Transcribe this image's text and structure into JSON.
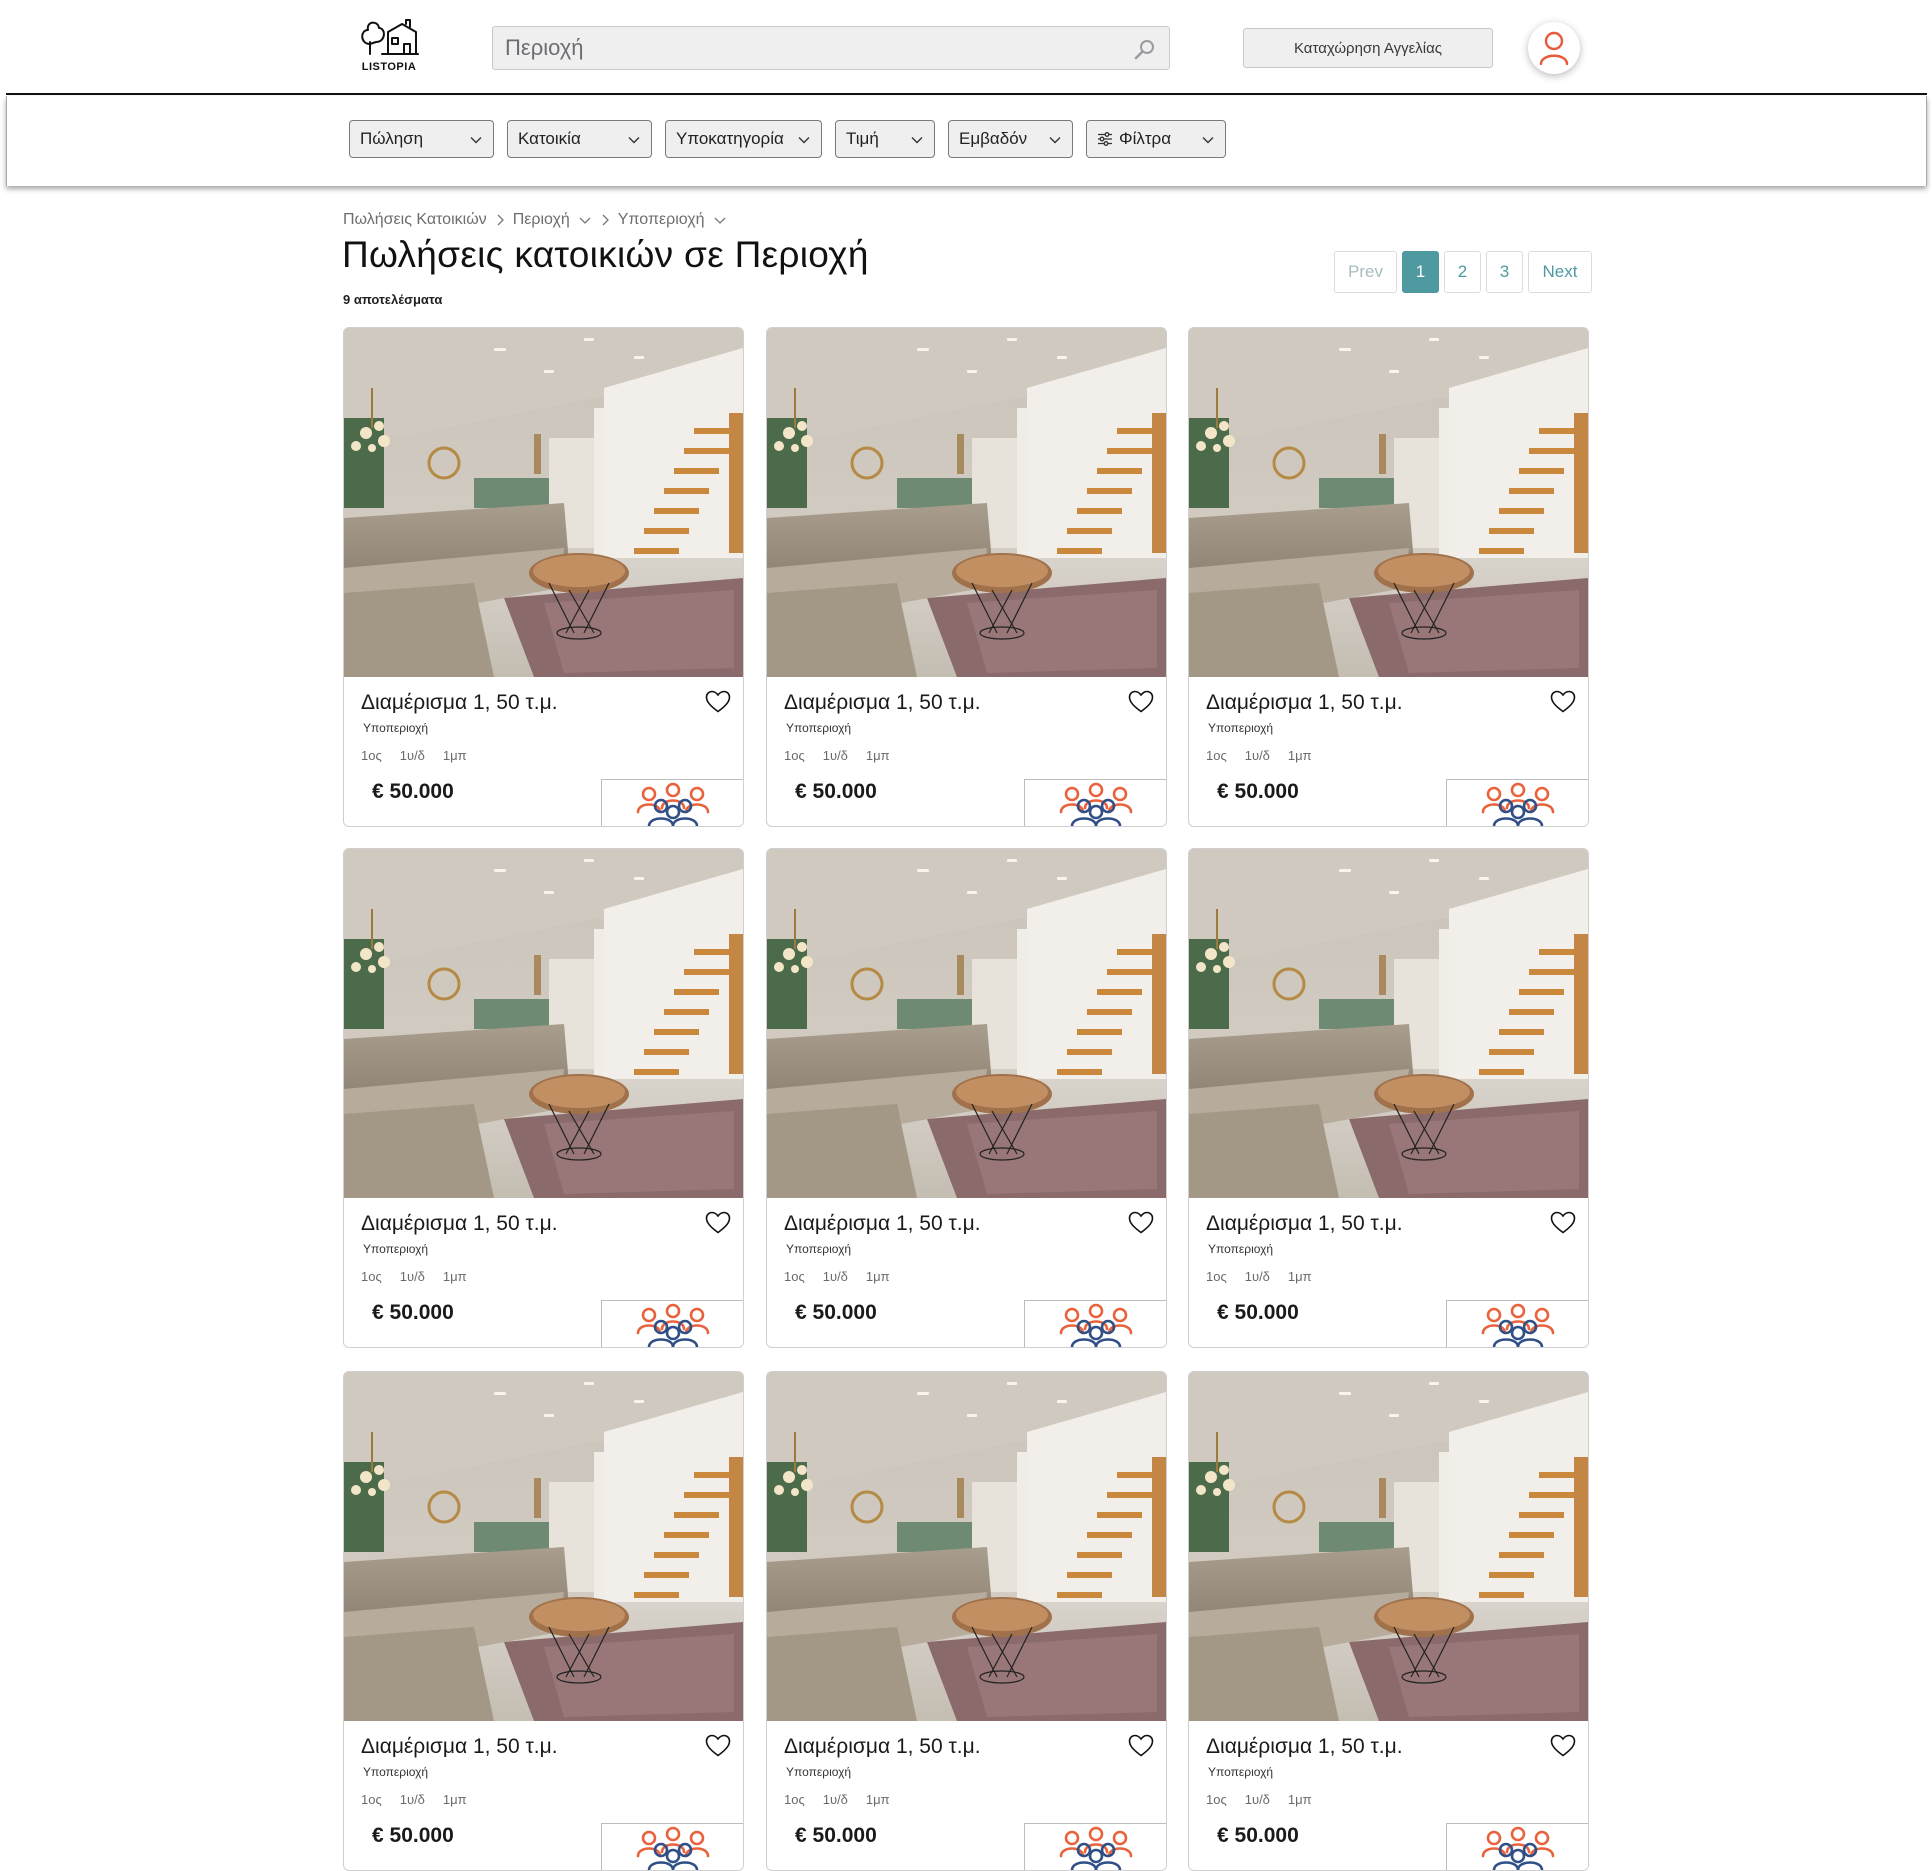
{
  "header": {
    "logo_text": "LISTOPIA",
    "search_placeholder": "Περιοχή",
    "post_listing_label": "Καταχώρηση Αγγελίας"
  },
  "filters": [
    {
      "label": "Πώληση"
    },
    {
      "label": "Κατοικία"
    },
    {
      "label": "Υποκατηγορία"
    },
    {
      "label": "Τιμή"
    },
    {
      "label": "Εμβαδόν"
    },
    {
      "label": "Φίλτρα"
    }
  ],
  "breadcrumb": {
    "root": "Πωλήσεις Κατοικιών",
    "area": "Περιοχή",
    "subarea": "Υποπεριοχή"
  },
  "page": {
    "title": "Πωλήσεις κατοικιών σε Περιοχή",
    "results_count": "9 αποτελέσματα"
  },
  "pagination": {
    "prev_label": "Prev",
    "pages": [
      "1",
      "2",
      "3"
    ],
    "current": "1",
    "next_label": "Next"
  },
  "listings": [
    {
      "title": "Διαμέρισμα 1, 50 τ.μ.",
      "subarea": "Υποπεριοχή",
      "floor": "1ος",
      "rooms": "1υ/δ",
      "baths": "1μπ",
      "price": "€ 50.000"
    },
    {
      "title": "Διαμέρισμα 1, 50 τ.μ.",
      "subarea": "Υποπεριοχή",
      "floor": "1ος",
      "rooms": "1υ/δ",
      "baths": "1μπ",
      "price": "€ 50.000"
    },
    {
      "title": "Διαμέρισμα 1, 50 τ.μ.",
      "subarea": "Υποπεριοχή",
      "floor": "1ος",
      "rooms": "1υ/δ",
      "baths": "1μπ",
      "price": "€ 50.000"
    },
    {
      "title": "Διαμέρισμα 1, 50 τ.μ.",
      "subarea": "Υποπεριοχή",
      "floor": "1ος",
      "rooms": "1υ/δ",
      "baths": "1μπ",
      "price": "€ 50.000"
    },
    {
      "title": "Διαμέρισμα 1, 50 τ.μ.",
      "subarea": "Υποπεριοχή",
      "floor": "1ος",
      "rooms": "1υ/δ",
      "baths": "1μπ",
      "price": "€ 50.000"
    },
    {
      "title": "Διαμέρισμα 1, 50 τ.μ.",
      "subarea": "Υποπεριοχή",
      "floor": "1ος",
      "rooms": "1υ/δ",
      "baths": "1μπ",
      "price": "€ 50.000"
    },
    {
      "title": "Διαμέρισμα 1, 50 τ.μ.",
      "subarea": "Υποπεριοχή",
      "floor": "1ος",
      "rooms": "1υ/δ",
      "baths": "1μπ",
      "price": "€ 50.000"
    },
    {
      "title": "Διαμέρισμα 1, 50 τ.μ.",
      "subarea": "Υποπεριοχή",
      "floor": "1ος",
      "rooms": "1υ/δ",
      "baths": "1μπ",
      "price": "€ 50.000"
    },
    {
      "title": "Διαμέρισμα 1, 50 τ.μ.",
      "subarea": "Υποπεριοχή",
      "floor": "1ος",
      "rooms": "1υ/δ",
      "baths": "1μπ",
      "price": "€ 50.000"
    }
  ],
  "colors": {
    "accent": "#4f9aa0",
    "user_icon": "#e85a3c",
    "agency_orange": "#e8623c",
    "agency_blue": "#2f4f86"
  },
  "icons": {
    "search": "magnifier-icon",
    "user": "user-icon",
    "heart": "heart-outline-icon",
    "filters": "sliders-icon",
    "chevron": "chevron-down-icon",
    "agency": "people-group-logo"
  }
}
